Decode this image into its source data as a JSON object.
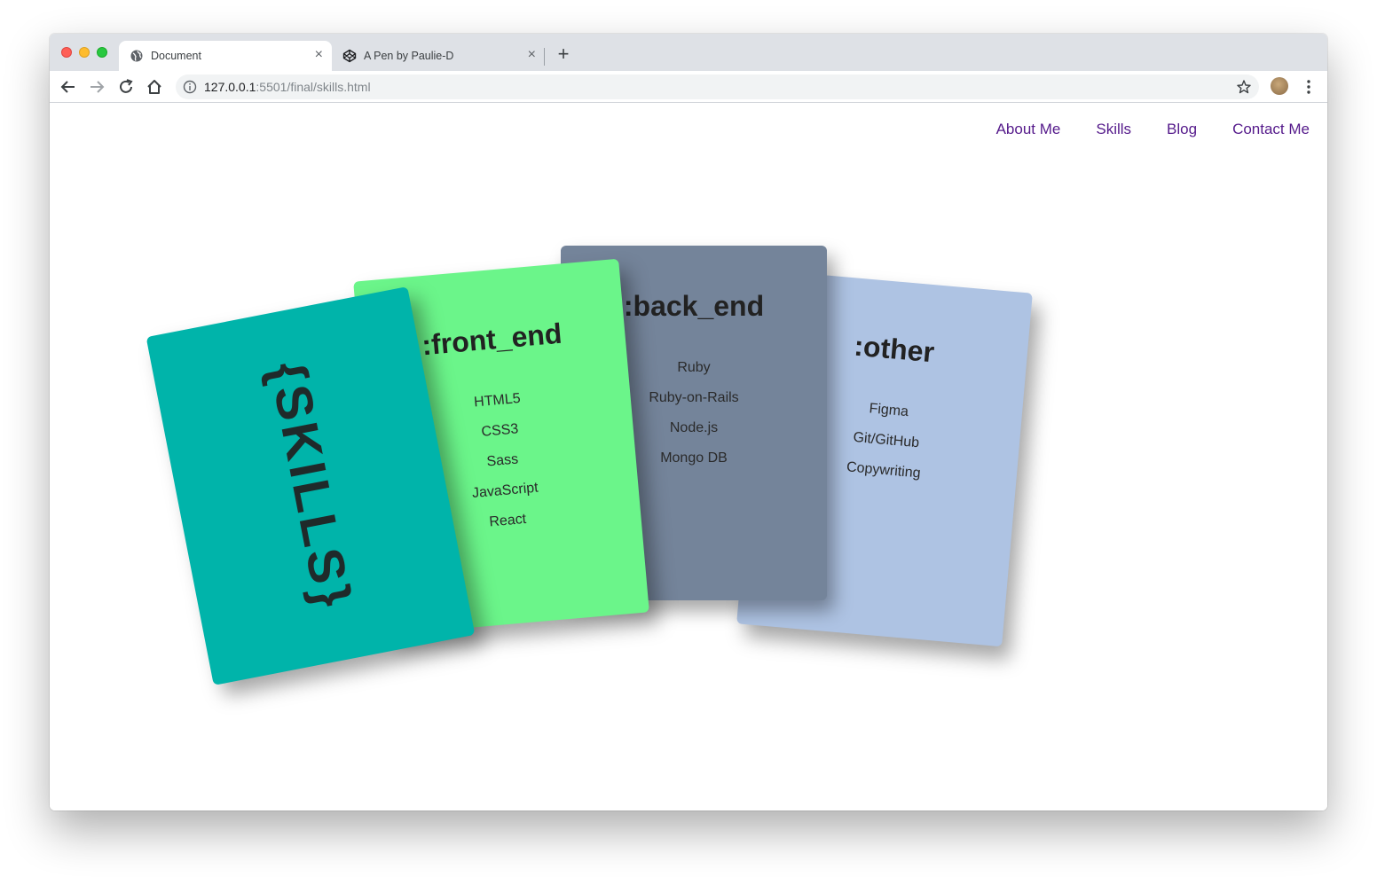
{
  "browser": {
    "tabs": [
      {
        "title": "Document",
        "active": true,
        "icon": "globe-icon"
      },
      {
        "title": "A Pen by Paulie-D",
        "active": false,
        "icon": "codepen-icon"
      }
    ],
    "url_host": "127.0.0.1",
    "url_rest": ":5501/final/skills.html"
  },
  "nav": {
    "items": [
      "About Me",
      "Skills",
      "Blog",
      "Contact Me"
    ],
    "link_color": "#551a8b"
  },
  "cards": {
    "skills": {
      "title": "{SKILLS}",
      "color": "#00b4aa"
    },
    "front_end": {
      "title": ":front_end",
      "items": [
        "HTML5",
        "CSS3",
        "Sass",
        "JavaScript",
        "React"
      ],
      "color": "#6bf58a"
    },
    "back_end": {
      "title": ":back_end",
      "items": [
        "Ruby",
        "Ruby-on-Rails",
        "Node.js",
        "Mongo DB"
      ],
      "color": "#74849a"
    },
    "other": {
      "title": ":other",
      "items": [
        "Figma",
        "Git/GitHub",
        "Copywriting"
      ],
      "color": "#aec3e3"
    }
  }
}
